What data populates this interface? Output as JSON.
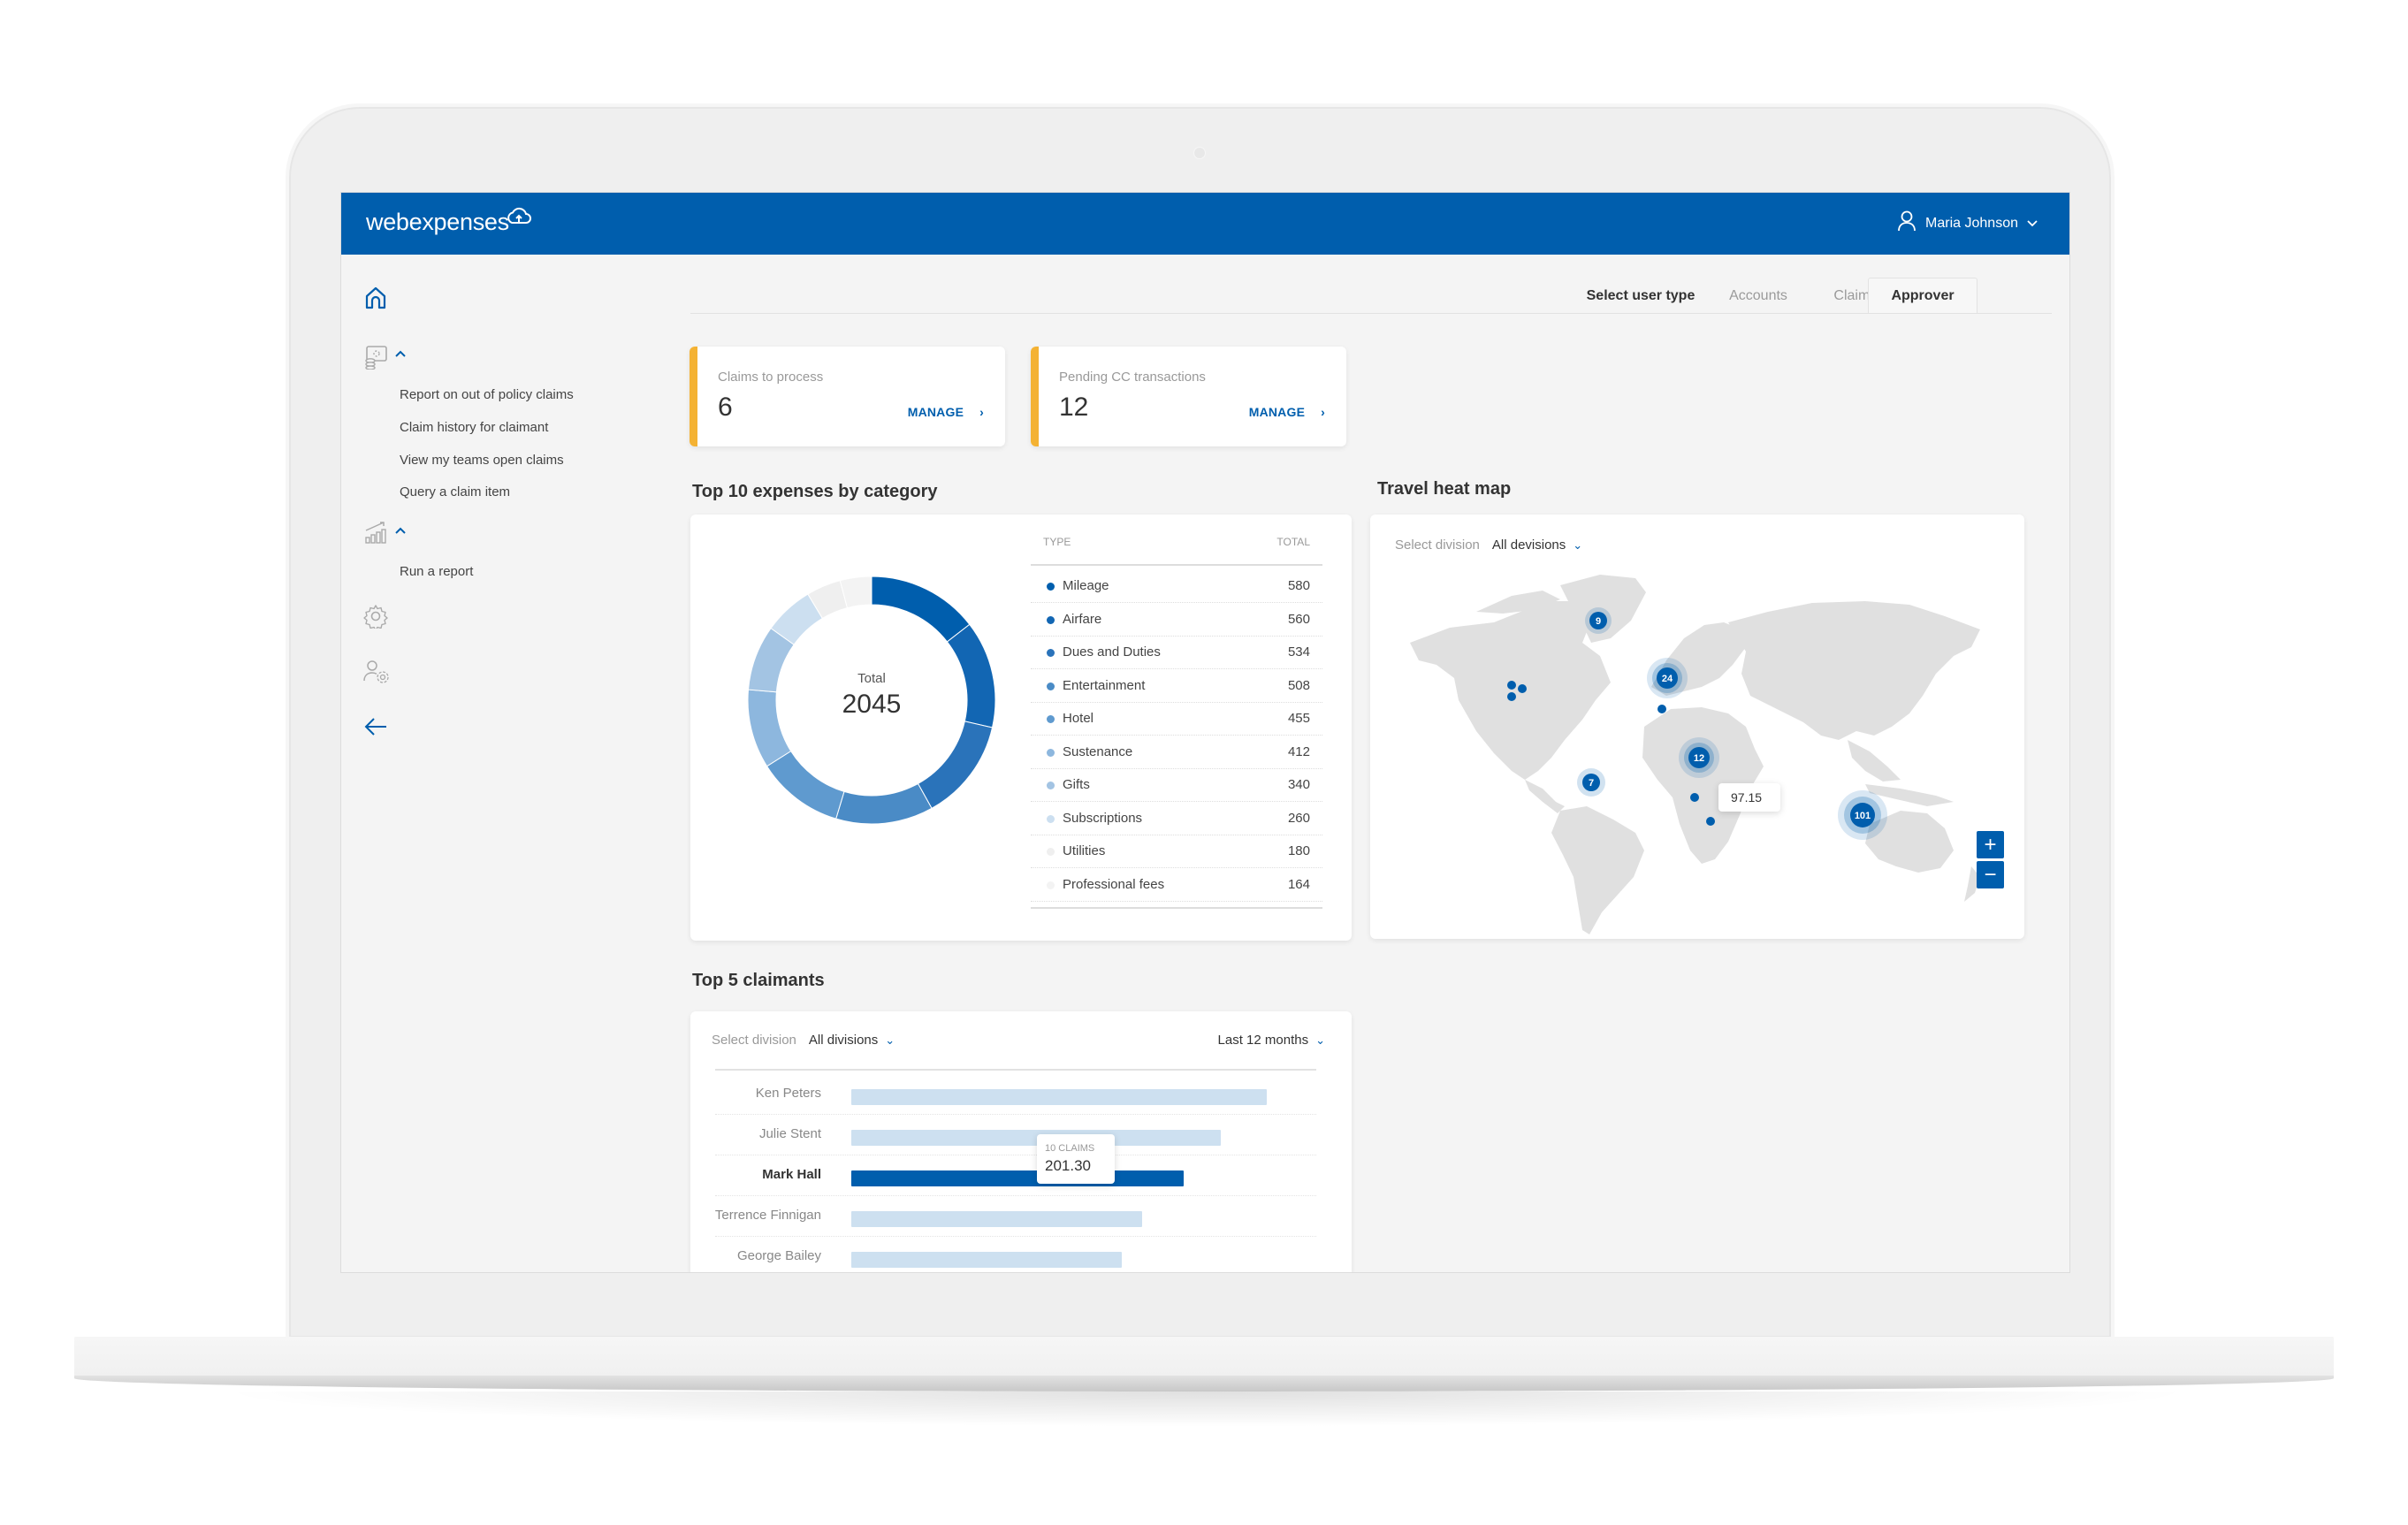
{
  "app": {
    "brand": "webexpenses",
    "user_name": "Maria Johnson"
  },
  "sidebar": {
    "groups": [
      {
        "icon": "claims-icon",
        "items": [
          {
            "label": "Report on out of policy claims"
          },
          {
            "label": "Claim history for claimant"
          },
          {
            "label": "View my teams open claims"
          },
          {
            "label": "Query a claim item"
          }
        ]
      },
      {
        "icon": "reports-icon",
        "items": [
          {
            "label": "Run a report"
          }
        ]
      }
    ],
    "icons": [
      "home-icon",
      "claims-icon",
      "reports-icon",
      "settings-icon",
      "user-settings-icon",
      "back-arrow-icon"
    ]
  },
  "user_type": {
    "label": "Select user type",
    "tabs": [
      {
        "label": "Accounts",
        "active": false
      },
      {
        "label": "Claimant",
        "active": false
      },
      {
        "label": "Approver",
        "active": true
      }
    ]
  },
  "kpis": [
    {
      "label": "Claims to process",
      "value": "6",
      "action": "MANAGE"
    },
    {
      "label": "Pending CC transactions",
      "value": "12",
      "action": "MANAGE"
    }
  ],
  "expenses": {
    "title": "Top 10 expenses by category",
    "total_label": "Total",
    "total_value": "2045",
    "col_type": "TYPE",
    "col_total": "TOTAL"
  },
  "heatmap": {
    "title": "Travel heat map",
    "select_label": "Select division",
    "select_value": "All devisions",
    "clusters": [
      {
        "label": "9",
        "region": "Greenland"
      },
      {
        "label": "24",
        "region": "Western Europe"
      },
      {
        "label": "12",
        "region": "Central Africa"
      },
      {
        "label": "7",
        "region": "South America"
      },
      {
        "label": "101",
        "region": "Australia"
      }
    ],
    "tooltip_value": "97.15",
    "zoom_in": "+",
    "zoom_out": "−"
  },
  "claimants": {
    "title": "Top 5 claimants",
    "select_label": "Select division",
    "select_value": "All divisions",
    "period": "Last 12 months",
    "tooltip_claims": "10 CLAIMS",
    "tooltip_value": "201.30",
    "highlighted": "Mark Hall"
  },
  "colors": {
    "brand": "#005EAD",
    "accent": "#F4B233"
  },
  "chart_data": [
    {
      "type": "pie",
      "title": "Top 10 expenses by category",
      "categories": [
        "Mileage",
        "Airfare",
        "Dues and Duties",
        "Entertainment",
        "Hotel",
        "Sustenance",
        "Gifts",
        "Subscriptions",
        "Utilities",
        "Professional fees"
      ],
      "values": [
        580,
        560,
        534,
        508,
        455,
        412,
        340,
        260,
        180,
        164
      ],
      "colors": [
        "#005EAD",
        "#1266B3",
        "#2A73BA",
        "#4A8BC6",
        "#5F9ACF",
        "#8DB7DE",
        "#A3C4E3",
        "#CCDFF0",
        "#EFEFEF",
        "#F3F3F3"
      ],
      "center_label": "Total",
      "center_value": "2045",
      "legend": "right"
    },
    {
      "type": "bar",
      "orientation": "horizontal",
      "title": "Top 5 claimants",
      "categories": [
        "Ken Peters",
        "Julie Stent",
        "Mark Hall",
        "Terrence Finnigan",
        "George Bailey"
      ],
      "values": [
        100,
        89,
        80,
        70,
        65
      ],
      "value_units": "relative (% of top claimant)",
      "highlighted_index": 2,
      "tooltip": {
        "category": "Mark Hall",
        "claims": "10 CLAIMS",
        "value": "201.30"
      }
    }
  ]
}
